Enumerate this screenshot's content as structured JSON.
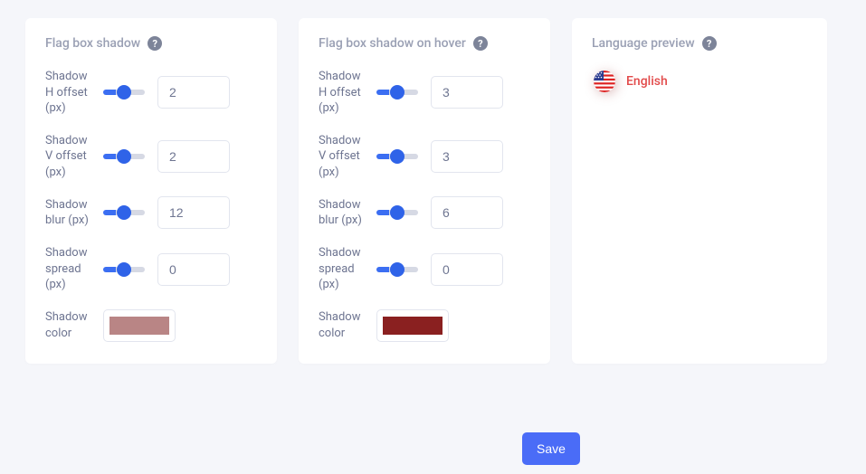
{
  "cards": {
    "shadow": {
      "title": "Flag box shadow",
      "fields": {
        "h_offset": {
          "label": "Shadow H offset (px)",
          "value": "2"
        },
        "v_offset": {
          "label": "Shadow V offset (px)",
          "value": "2"
        },
        "blur": {
          "label": "Shadow blur (px)",
          "value": "12"
        },
        "spread": {
          "label": "Shadow spread (px)",
          "value": "0"
        },
        "color": {
          "label": "Shadow color",
          "value": "#b98585"
        }
      }
    },
    "shadow_hover": {
      "title": "Flag box shadow on hover",
      "fields": {
        "h_offset": {
          "label": "Shadow H offset (px)",
          "value": "3"
        },
        "v_offset": {
          "label": "Shadow V offset (px)",
          "value": "3"
        },
        "blur": {
          "label": "Shadow blur (px)",
          "value": "6"
        },
        "spread": {
          "label": "Shadow spread (px)",
          "value": "0"
        },
        "color": {
          "label": "Shadow color",
          "value": "#8a2020"
        }
      }
    },
    "preview": {
      "title": "Language preview",
      "language_label": "English"
    }
  },
  "buttons": {
    "save": "Save"
  }
}
